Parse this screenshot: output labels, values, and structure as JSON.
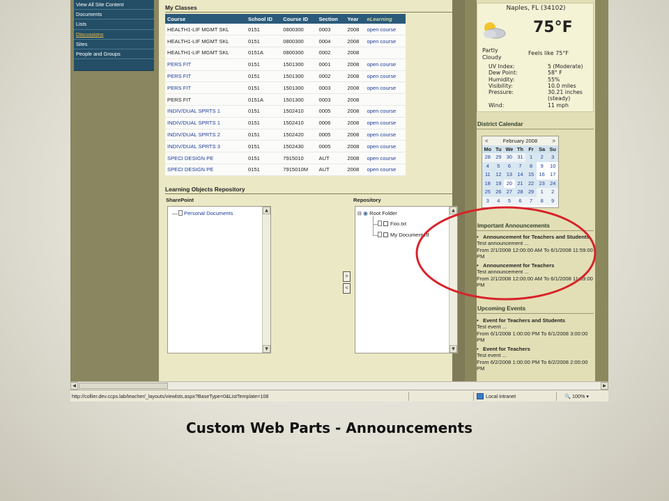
{
  "left_nav": {
    "items": [
      {
        "label": "View All Site Content"
      },
      {
        "label": "Documents"
      },
      {
        "label": "Lists"
      },
      {
        "label": "Discussions"
      },
      {
        "label": "Sites"
      },
      {
        "label": "People and Groups"
      }
    ],
    "active_index": 3
  },
  "my_classes": {
    "title": "My Classes",
    "columns": [
      "Course",
      "School ID",
      "Course ID",
      "Section",
      "Year",
      "eLearning"
    ],
    "rows": [
      [
        "HEALTH1-LIF MGMT SKL",
        "0151",
        "0800300",
        "0003",
        "2008",
        "open course"
      ],
      [
        "HEALTH1-LIF MGMT SKL",
        "0151",
        "0800300",
        "0004",
        "2008",
        "open course"
      ],
      [
        "HEALTH1-LIF MGMT SKL",
        "0151A",
        "0800300",
        "0002",
        "2008",
        ""
      ],
      [
        "PERS FIT",
        "0151",
        "1501300",
        "0001",
        "2008",
        "open course"
      ],
      [
        "PERS FIT",
        "0151",
        "1501300",
        "0002",
        "2008",
        "open course"
      ],
      [
        "PERS FIT",
        "0151",
        "1501300",
        "0003",
        "2008",
        "open course"
      ],
      [
        "PERS FIT",
        "0151A",
        "1501300",
        "0003",
        "2008",
        ""
      ],
      [
        "INDIV/DUAL SPRTS 1",
        "0151",
        "1502410",
        "0005",
        "2008",
        "open course"
      ],
      [
        "INDIV/DUAL SPRTS 1",
        "0151",
        "1502410",
        "0006",
        "2008",
        "open course"
      ],
      [
        "INDIV/DUAL SPRTS 2",
        "0151",
        "1502420",
        "0005",
        "2008",
        "open course"
      ],
      [
        "INDIV/DUAL SPRTS 3",
        "0151",
        "1502430",
        "0005",
        "2008",
        "open course"
      ],
      [
        "SPECI DESIGN PE",
        "0151",
        "7915010",
        "AUT",
        "2008",
        "open course"
      ],
      [
        "SPECI DESIGN PE",
        "0151",
        "7915010M",
        "AUT",
        "2008",
        "open course"
      ]
    ]
  },
  "repository": {
    "title": "Learning Objects Repository",
    "sharepoint_label": "SharePoint",
    "repository_label": "Repository",
    "sharepoint_tree": [
      "Personal Documents"
    ],
    "repository_tree": {
      "root": "Root Folder",
      "files": [
        "Foo.txt",
        "My Document.rtf"
      ]
    },
    "move_right": ">",
    "move_left": "<"
  },
  "weather": {
    "location": "Naples, FL (34102)",
    "temp": "75°F",
    "condition": "Partly Cloudy",
    "feels_like": "Feels like 75°F",
    "details": [
      {
        "k": "UV Index:",
        "v": "5 (Moderate)"
      },
      {
        "k": "Dew Point:",
        "v": "58° F"
      },
      {
        "k": "Humidity:",
        "v": "55%"
      },
      {
        "k": "Visibility:",
        "v": "10.0 miles"
      },
      {
        "k": "Pressure:",
        "v": "30.21 inches"
      },
      {
        "k": "",
        "v": "(steady)"
      },
      {
        "k": "Wind:",
        "v": "11 mph"
      }
    ],
    "icon": "partly-cloudy-icon"
  },
  "calendar": {
    "heading": "District Calendar",
    "month": "February 2008",
    "prev": "<",
    "next": ">",
    "dows": [
      "Mo",
      "Tu",
      "We",
      "Th",
      "Fr",
      "Sa",
      "Su"
    ],
    "weeks": [
      [
        "28",
        "29",
        "30",
        "31",
        "1",
        "2",
        "3"
      ],
      [
        "4",
        "5",
        "6",
        "7",
        "8",
        "9",
        "10"
      ],
      [
        "11",
        "12",
        "13",
        "14",
        "15",
        "16",
        "17"
      ],
      [
        "18",
        "19",
        "20",
        "21",
        "22",
        "23",
        "24"
      ],
      [
        "25",
        "26",
        "27",
        "28",
        "29",
        "1",
        "2"
      ],
      [
        "3",
        "4",
        "5",
        "6",
        "7",
        "8",
        "9"
      ]
    ],
    "today": "20"
  },
  "announcements": {
    "heading": "Important Announcements",
    "items": [
      {
        "title": "Announcement for Teachers and Students",
        "body": "Test announcement ...",
        "range": "From 2/1/2008 12:00:00 AM To 6/1/2008 11:59:00 PM"
      },
      {
        "title": "Announcement for Teachers",
        "body": "Test announcement ...",
        "range": "From 2/1/2008 12:00:00 AM To 6/1/2008 11:59:00 PM"
      }
    ]
  },
  "events": {
    "heading": "Upcoming Events",
    "items": [
      {
        "title": "Event for Teachers and Students",
        "body": "Test event ...",
        "range": "From 6/1/2008 1:00:00 PM To 6/1/2008 3:00:00 PM"
      },
      {
        "title": "Event for Teachers",
        "body": "Test event ...",
        "range": "From 6/2/2008 1:00:00 PM To 6/2/2008 2:00:00 PM"
      }
    ]
  },
  "status_bar": {
    "url": "http://collier.dev.ccps.lab/teacher/_layouts/viewlsts.aspx?BaseType=0&ListTemplate=108",
    "zone": "Local intranet",
    "zoom": "100%"
  },
  "caption": "Custom Web Parts - Announcements",
  "colors": {
    "highlight_circle": "#d8232a",
    "nav_bg": "#234e66",
    "table_header": "#2a5a79"
  }
}
